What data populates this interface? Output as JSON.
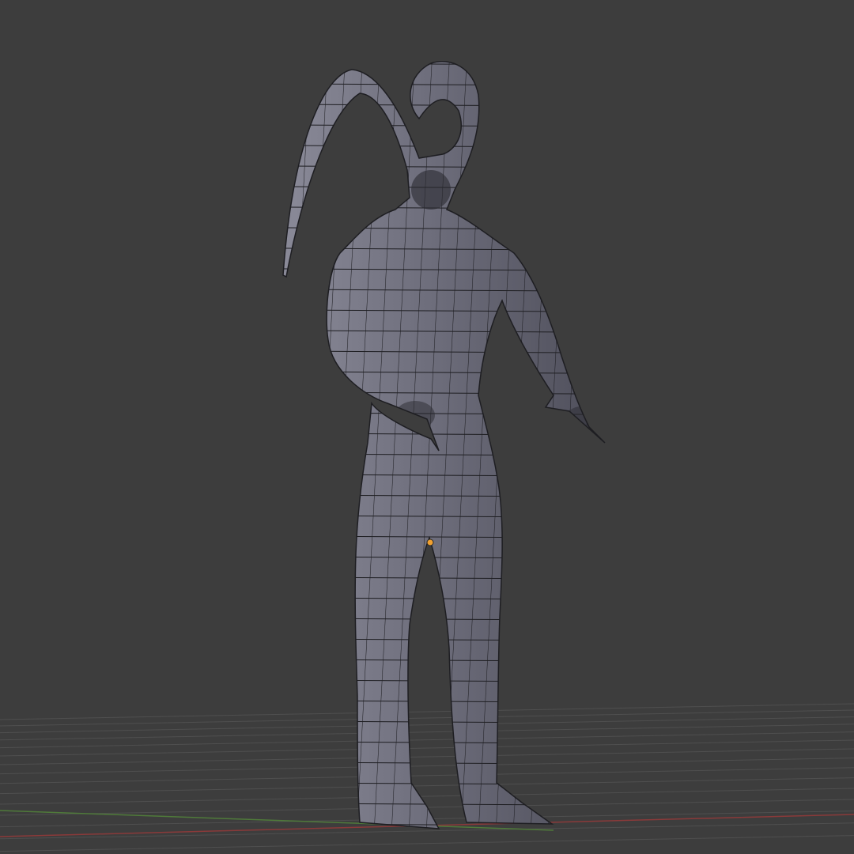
{
  "viewport": {
    "mode": "3d-viewport-solid-wireframe",
    "colors": {
      "background": "#3d3d3d",
      "grid": "#4f4f4f",
      "x_axis": "#8a3a3a",
      "y_axis": "#4f7a3a",
      "mesh_fill": "#6e6e7c",
      "mesh_wire": "#1e1e22",
      "origin": "#f0a030"
    },
    "object": {
      "icon": "mesh-object",
      "origin_icon": "object-origin-dot"
    }
  }
}
